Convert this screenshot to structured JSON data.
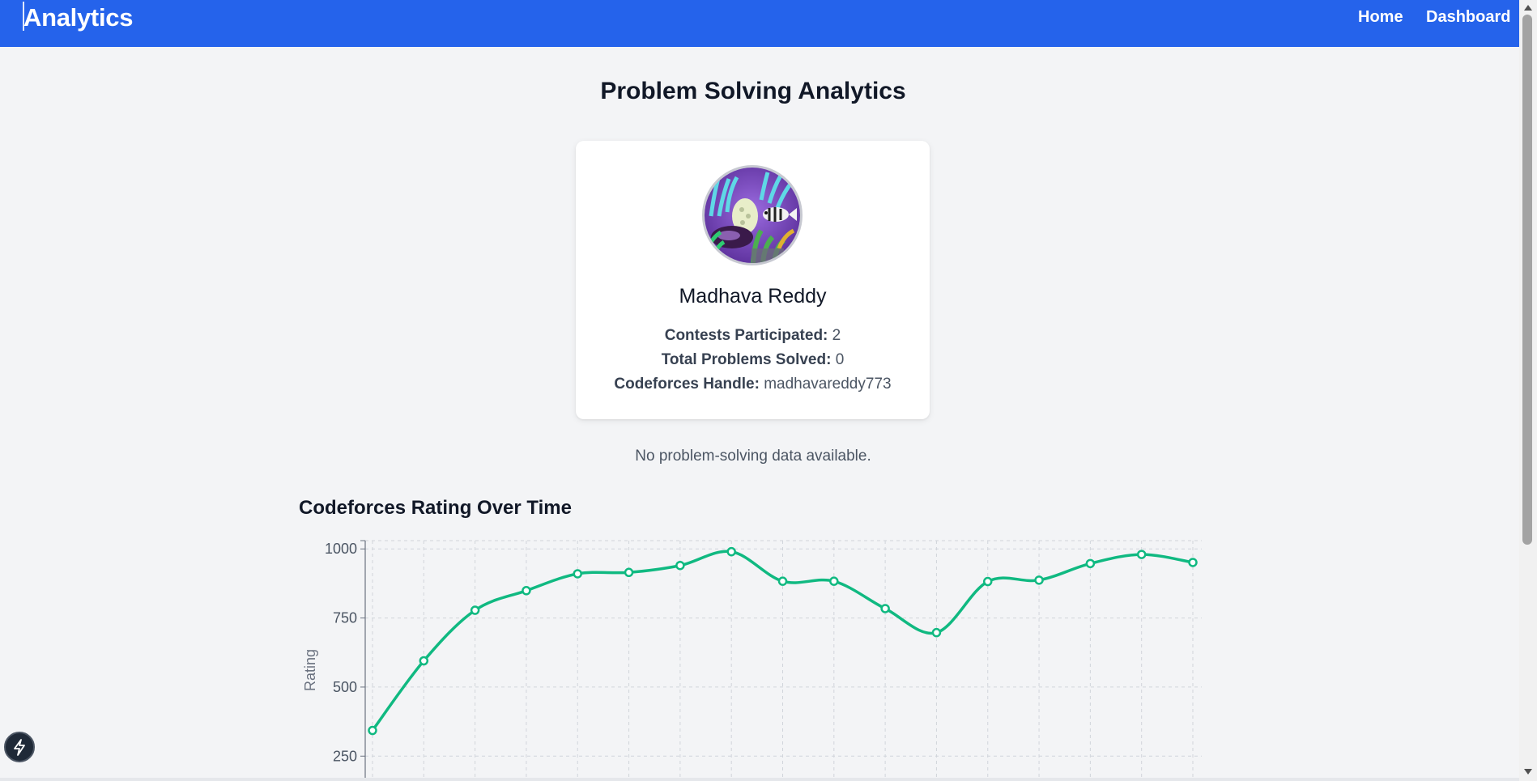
{
  "header": {
    "brand": "Analytics",
    "nav": [
      {
        "label": "Home"
      },
      {
        "label": "Dashboard"
      }
    ],
    "color": "#2563eb"
  },
  "page": {
    "title": "Problem Solving Analytics",
    "no_data_message": "No problem-solving data available."
  },
  "profile": {
    "name": "Madhava Reddy",
    "avatar_icon": "aquarium-fish-avatar",
    "stats": [
      {
        "label": "Contests Participated:",
        "value": "2"
      },
      {
        "label": "Total Problems Solved:",
        "value": "0"
      },
      {
        "label": "Codeforces Handle:",
        "value": "madhavareddy773"
      }
    ]
  },
  "chart_section": {
    "title": "Codeforces Rating Over Time"
  },
  "chart_data": {
    "type": "line",
    "title": "Codeforces Rating Over Time",
    "xlabel": "",
    "ylabel": "Rating",
    "y_ticks": [
      250,
      500,
      750,
      1000
    ],
    "ylim_visible": [
      160,
      1030
    ],
    "grid": true,
    "line_color": "#10b981",
    "series": [
      {
        "values": [
          343,
          595,
          778,
          849,
          910,
          915,
          940,
          990,
          883,
          883,
          784,
          697,
          882,
          887,
          947,
          980,
          951
        ]
      }
    ]
  },
  "fab_icon": "lightning-icon"
}
